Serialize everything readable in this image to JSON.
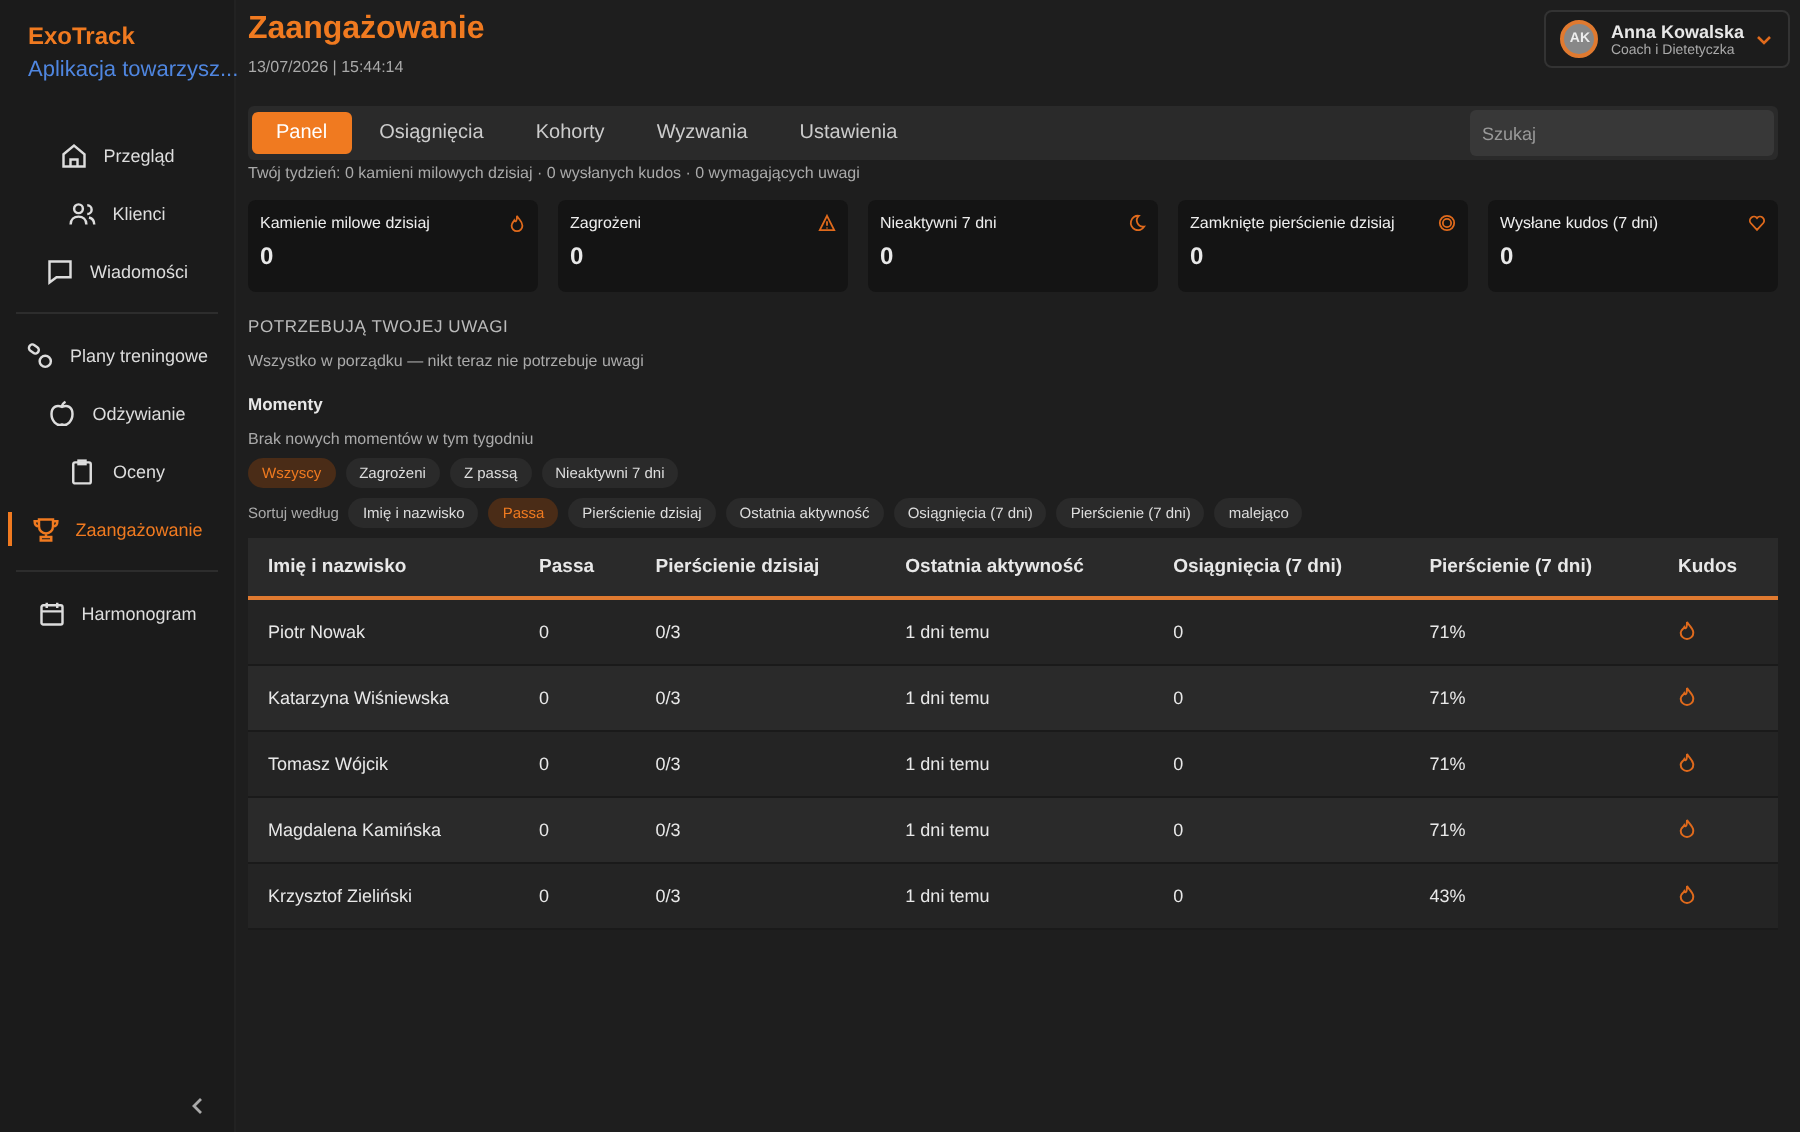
{
  "brand": {
    "name": "ExoTrack",
    "subtitle": "Aplikacja towarzysz..."
  },
  "sidebar": {
    "sections": [
      {
        "items": [
          {
            "label": "Przegląd",
            "selected": false
          },
          {
            "label": "Klienci",
            "selected": false
          },
          {
            "label": "Wiadomości",
            "selected": false
          }
        ]
      },
      {
        "items": [
          {
            "label": "Plany treningowe",
            "selected": false
          },
          {
            "label": "Odżywianie",
            "selected": false
          },
          {
            "label": "Oceny",
            "selected": false
          },
          {
            "label": "Zaangażowanie",
            "selected": true
          }
        ]
      },
      {
        "items": [
          {
            "label": "Harmonogram",
            "selected": false
          }
        ]
      }
    ]
  },
  "header": {
    "title": "Zaangażowanie",
    "datetime": "13/07/2026 | 15:44:14"
  },
  "user": {
    "initials": "AK",
    "name": "Anna Kowalska",
    "role": "Coach i Dietetyczka"
  },
  "tabs": [
    {
      "label": "Panel",
      "selected": true
    },
    {
      "label": "Osiągnięcia",
      "selected": false
    },
    {
      "label": "Kohorty",
      "selected": false
    },
    {
      "label": "Wyzwania",
      "selected": false
    },
    {
      "label": "Ustawienia",
      "selected": false
    }
  ],
  "search": {
    "placeholder": "Szukaj"
  },
  "summary": "Twój tydzień: 0 kamieni milowych dzisiaj · 0 wysłanych kudos · 0 wymagających uwagi",
  "stats": [
    {
      "label": "Kamienie milowe dzisiaj",
      "value": "0"
    },
    {
      "label": "Zagrożeni",
      "value": "0"
    },
    {
      "label": "Nieaktywni 7 dni",
      "value": "0"
    },
    {
      "label": "Zamknięte pierścienie dzisiaj",
      "value": "0"
    },
    {
      "label": "Wysłane kudos (7 dni)",
      "value": "0"
    }
  ],
  "attention": {
    "heading": "POTRZEBUJĄ TWOJEJ UWAGI",
    "message": "Wszystko w porządku — nikt teraz nie potrzebuje uwagi"
  },
  "moments": {
    "heading": "Momenty",
    "message": "Brak nowych momentów w tym tygodniu"
  },
  "filters": [
    {
      "label": "Wszyscy",
      "selected": true
    },
    {
      "label": "Zagrożeni",
      "selected": false
    },
    {
      "label": "Z passą",
      "selected": false
    },
    {
      "label": "Nieaktywni 7 dni",
      "selected": false
    }
  ],
  "sort": {
    "label": "Sortuj według",
    "options": [
      {
        "label": "Imię i nazwisko",
        "selected": false
      },
      {
        "label": "Passa",
        "selected": true
      },
      {
        "label": "Pierścienie dzisiaj",
        "selected": false
      },
      {
        "label": "Ostatnia aktywność",
        "selected": false
      },
      {
        "label": "Osiągnięcia (7 dni)",
        "selected": false
      },
      {
        "label": "Pierścienie (7 dni)",
        "selected": false
      },
      {
        "label": "malejąco",
        "selected": false
      }
    ]
  },
  "table": {
    "columns": [
      "Imię i nazwisko",
      "Passa",
      "Pierścienie dzisiaj",
      "Ostatnia aktywność",
      "Osiągnięcia (7 dni)",
      "Pierścienie (7 dni)",
      "Kudos"
    ],
    "rows": [
      [
        "Piotr Nowak",
        "0",
        "0/3",
        "1 dni temu",
        "0",
        "71%"
      ],
      [
        "Katarzyna Wiśniewska",
        "0",
        "0/3",
        "1 dni temu",
        "0",
        "71%"
      ],
      [
        "Tomasz Wójcik",
        "0",
        "0/3",
        "1 dni temu",
        "0",
        "71%"
      ],
      [
        "Magdalena Kamińska",
        "0",
        "0/3",
        "1 dni temu",
        "0",
        "71%"
      ],
      [
        "Krzysztof Zieliński",
        "0",
        "0/3",
        "1 dni temu",
        "0",
        "43%"
      ]
    ]
  }
}
